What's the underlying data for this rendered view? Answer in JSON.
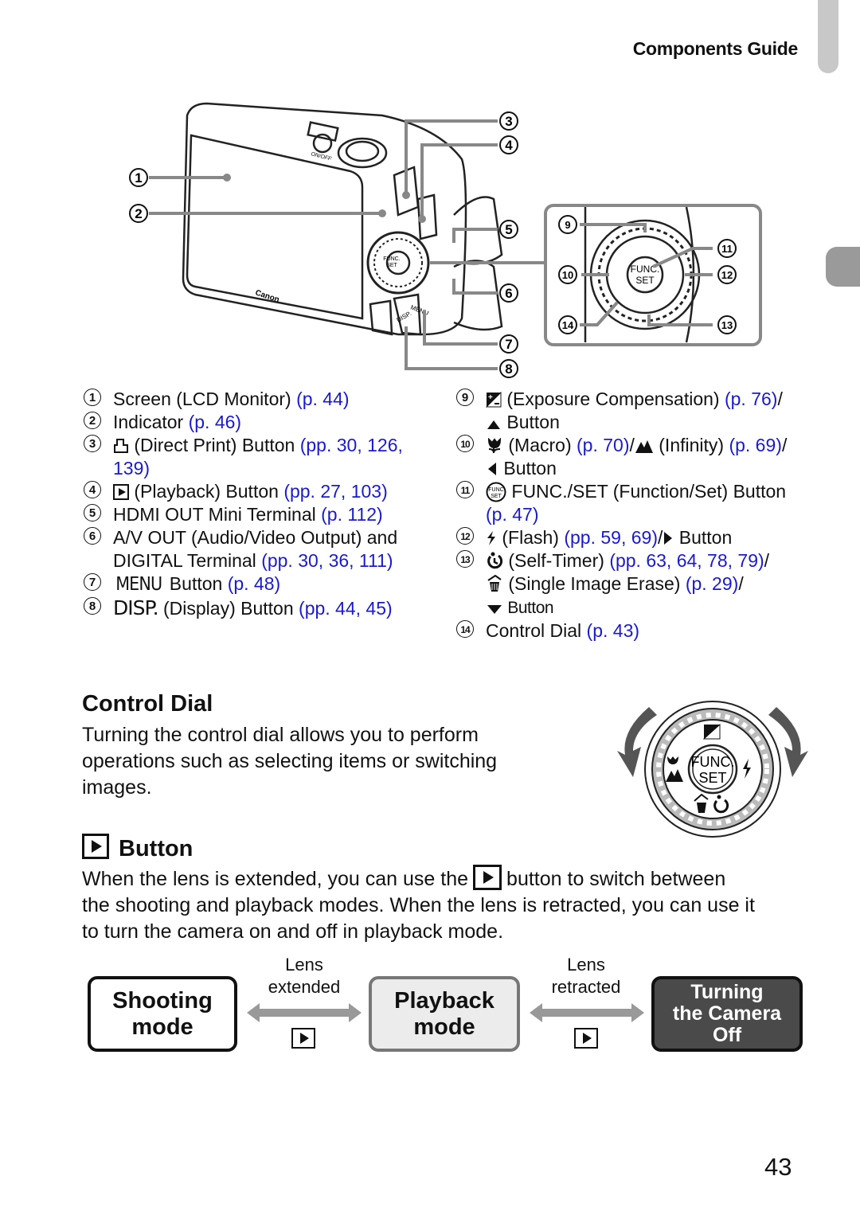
{
  "header": {
    "section_title": "Components Guide"
  },
  "diagram": {
    "callouts_main": [
      "1",
      "2",
      "3",
      "4",
      "5",
      "6",
      "7",
      "8"
    ],
    "callouts_inset": [
      "9",
      "10",
      "11",
      "12",
      "13",
      "14"
    ],
    "camera_labels": {
      "on_off": "ON/OFF",
      "func": "FUNC.",
      "set": "SET",
      "menu": "MENU",
      "disp": "DISP.",
      "brand": "Canon"
    }
  },
  "legend_left": [
    {
      "num": "1",
      "text": "Screen (LCD Monitor) ",
      "refs": "(p. 44)"
    },
    {
      "num": "2",
      "text": "Indicator ",
      "refs": "(p. 46)"
    },
    {
      "num": "3",
      "icon": "direct-print-icon",
      "text": " (Direct Print) Button ",
      "refs": "(pp. 30, 126,",
      "refs2": "139)"
    },
    {
      "num": "4",
      "icon": "playback-icon",
      "text": " (Playback) Button ",
      "refs": "(pp. 27, 103)"
    },
    {
      "num": "5",
      "text": "HDMI OUT Mini Terminal ",
      "refs": "(p. 112)"
    },
    {
      "num": "6",
      "text": "A/V OUT (Audio/Video Output) and",
      "text2": "DIGITAL Terminal ",
      "refs2": "(pp. 30, 36, 111)"
    },
    {
      "num": "7",
      "icon_text": "MENU",
      "text": " Button ",
      "refs": "(p. 48)"
    },
    {
      "num": "8",
      "icon_text": "DISP.",
      "text": " (Display) Button ",
      "refs": "(pp. 44, 45)"
    }
  ],
  "legend_right": [
    {
      "num": "9",
      "icon": "exposure-compensation-icon",
      "text": " (Exposure Compensation) ",
      "refs": "(p. 76)",
      "tail": "/",
      "text2": " Button",
      "icon2": "up-arrow-icon"
    },
    {
      "num": "10",
      "icon": "macro-icon",
      "text": " (Macro) ",
      "refs": "(p. 70)",
      "mid": "/",
      "icon_b": "infinity-icon",
      "text_b": " (Infinity) ",
      "refs_b": "(p. 69)",
      "tail": "/",
      "text2": " Button",
      "icon2": "left-arrow-icon"
    },
    {
      "num": "11",
      "icon": "func-set-icon",
      "text": " FUNC./SET (Function/Set) Button",
      "refs2": "(p. 47)"
    },
    {
      "num": "12",
      "icon": "flash-icon",
      "text": " (Flash) ",
      "refs": "(pp. 59, 69)",
      "tail": "/",
      "text_b": " Button",
      "icon_b": "right-arrow-icon"
    },
    {
      "num": "13",
      "icon": "self-timer-icon",
      "text": " (Self-Timer) ",
      "refs": "(pp. 63, 64, 78, 79)",
      "tail": "/",
      "icon2": "erase-icon",
      "text2": " (Single Image Erase) ",
      "refs2": "(p. 29)",
      "tail2": "/",
      "icon3": "down-arrow-icon",
      "text3": " Button"
    },
    {
      "num": "14",
      "text": "Control Dial ",
      "refs": "(p. 43)"
    }
  ],
  "control_dial": {
    "title": "Control Dial",
    "body": [
      "Turning the control dial allows you to perform",
      "operations such as selecting items or switching",
      "images."
    ],
    "dial_func": "FUNC.",
    "dial_set": "SET"
  },
  "playback_button": {
    "title": "Button",
    "body_line1_a": "When the lens is extended, you can use the",
    "body_line1_b": "button to switch between",
    "body_line2": "the shooting and playback modes. When the lens is retracted, you can use it",
    "body_line3": "to turn the camera on and off in playback mode."
  },
  "flow": {
    "modes": [
      {
        "line1": "Shooting",
        "line2": "mode"
      },
      {
        "line1": "Playback",
        "line2": "mode"
      },
      {
        "line1": "Turning",
        "line2": "the Camera",
        "line3": "Off"
      }
    ],
    "transitions": [
      {
        "line1": "Lens",
        "line2": "extended"
      },
      {
        "line1": "Lens",
        "line2": "retracted"
      }
    ]
  },
  "page_number": "43"
}
